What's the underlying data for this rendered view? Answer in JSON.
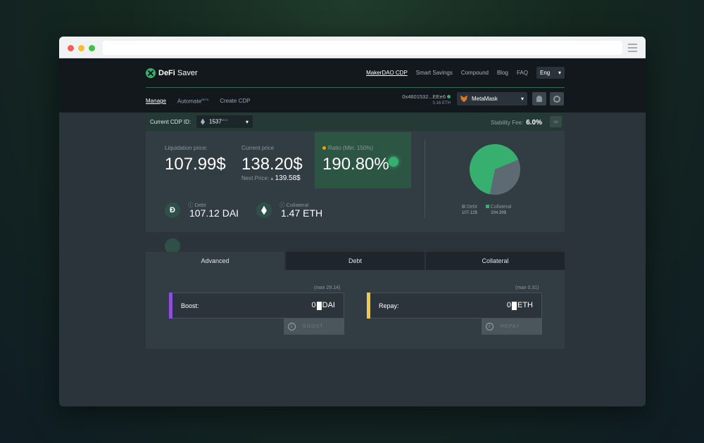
{
  "nav": {
    "brand_prefix": "DeFi",
    "brand_suffix": " Saver",
    "links": [
      "MakerDAO CDP",
      "Smart Savings",
      "Compound",
      "Blog",
      "FAQ"
    ],
    "language": "Eng",
    "icons": {
      "chevron": "▾"
    }
  },
  "subnav": {
    "manage": "Manage",
    "automate": "Automate",
    "automate_badge": "BETA",
    "create": "Create CDP"
  },
  "wallet": {
    "address": "0x4601532...EEe6",
    "balance": "0.16 ETH",
    "provider": "MetaMask"
  },
  "cdp": {
    "label": "Current CDP ID:",
    "id": "1537",
    "id_tag": "MCD",
    "fee_label": "Stability Fee:",
    "fee_value": "6.0%"
  },
  "stats": {
    "liq_label": "Liquidation price:",
    "liq_value": "107.99$",
    "price_label": "Current price",
    "price_value": "138.20$",
    "next_label": "Next Price: ",
    "next_arrow": "▴",
    "next_value": "139.58$",
    "ratio_label": "Ratio (Min: 150%)",
    "ratio_value": "190.80%",
    "debt_label": "ⓘ Debt",
    "debt_value": "107.12 DAI",
    "coll_label": "ⓘ Collateral",
    "coll_value": "1.47 ETH"
  },
  "chart_data": {
    "type": "pie",
    "series": [
      {
        "name": "Debt",
        "value": 107.12,
        "label": "107.12$",
        "color": "#5d6a73"
      },
      {
        "name": "Collateral",
        "value": 204.39,
        "label": "204.39$",
        "color": "#37b06f"
      }
    ]
  },
  "tabs": [
    "Advanced",
    "Debt",
    "Collateral"
  ],
  "boost": {
    "max": "(max 29.14)",
    "label": "Boost:",
    "value": "0",
    "unit": "DAI",
    "button": "BOOST",
    "accent": "#8e4ed6"
  },
  "repay": {
    "max": "(max 0.31)",
    "label": "Repay:",
    "value": "0",
    "unit": "ETH",
    "button": "REPAY",
    "accent": "#f2c94c"
  }
}
